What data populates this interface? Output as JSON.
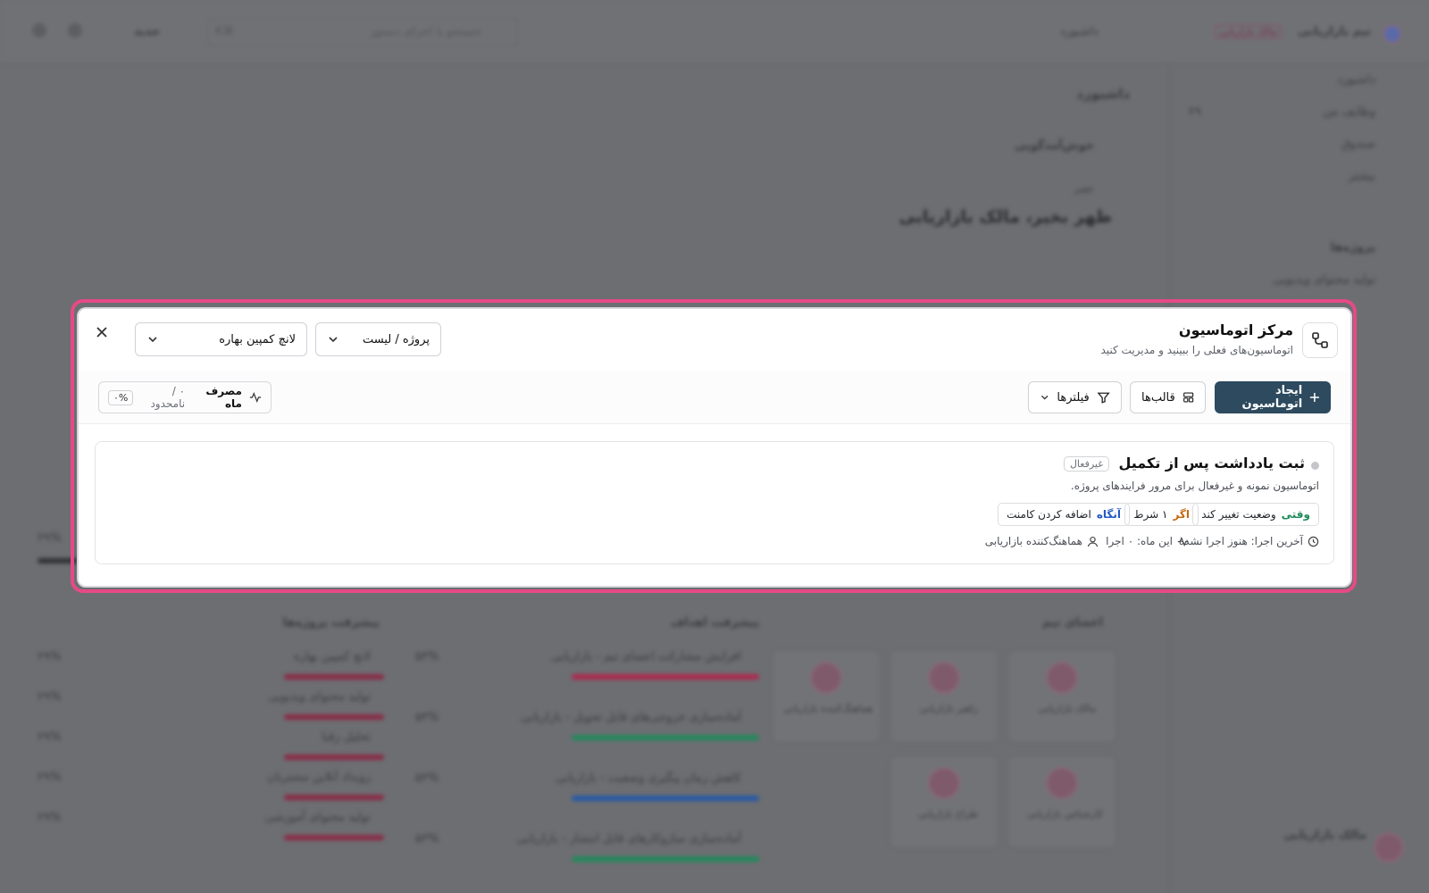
{
  "background": {
    "app_name": "تیم بازاریابی",
    "role_badge": "مالک بازاریابی",
    "dashboard_label": "داشبورد",
    "search_placeholder": "جستجو یا اجرای دستور",
    "search_shortcut": "⌘K",
    "new_label": "جدید",
    "page_title": "داشبورد",
    "welcome_label": "خوش‌آمدگویی",
    "greeting_small": "عصر",
    "greeting": "ظهر بخیر، مالک بازاریابی",
    "sidebar_items": [
      {
        "label": "داشبورد",
        "count": ""
      },
      {
        "label": "وظایف من",
        "count": "۲۹"
      },
      {
        "label": "صندوق",
        "count": ""
      },
      {
        "label": "بیشتر",
        "count": ""
      },
      {
        "label": "پروژه‌ها",
        "count": ""
      },
      {
        "label": "تولید محتوای ویدیویی",
        "count": "۲۹"
      }
    ],
    "team_members_title": "اعضای تیم",
    "goals_progress_title": "پیشرفت اهداف",
    "projects_progress_title": "پیشرفت پروژه‌ها",
    "team_members": [
      {
        "name": "مالک بازاریابی"
      },
      {
        "name": "راهبر بازاریابی"
      },
      {
        "name": "هماهنگ‌کننده بازاریابی"
      },
      {
        "name": "کارشناس بازاریابی"
      },
      {
        "name": "طراح بازاریابی"
      }
    ],
    "goals": [
      {
        "label": "افزایش مشارکت اعضای تیم - بازاریابی",
        "pct": "۵۳%",
        "color": "#b0254e"
      },
      {
        "label": "آماده‌سازی خروجی‌های قابل تحویل - بازاریابی",
        "pct": "۵۳%",
        "color": "#1f8a5b"
      },
      {
        "label": "کاهش زمان پیگیری وضعیت - بازاریابی",
        "pct": "۵۳%",
        "color": "#2458a8"
      },
      {
        "label": "آماده‌سازی سازوکارهای قابل انتشار - بازاریابی",
        "pct": "۵۳%",
        "color": "#1f8a5b"
      }
    ],
    "projects": [
      {
        "label": "لانچ کمپین بهاره",
        "pct": "۲۹%"
      },
      {
        "label": "تولید محتوای ویدیویی",
        "pct": "۲۹%"
      },
      {
        "label": "تحلیل رقبا",
        "pct": "۲۹%"
      },
      {
        "label": "رویداد آنلاین مشتریان",
        "pct": "۲۹%"
      },
      {
        "label": "تولید محتوای آموزشی",
        "pct": "۲۹%"
      }
    ],
    "user_name": "مالک بازاریابی",
    "left_pct": "۲۹%"
  },
  "modal": {
    "title": "مرکز اتوماسیون",
    "subtitle": "اتوماسیون‌های فعلی را ببینید و مدیریت کنید",
    "project_select": "پروژه / لیست",
    "campaign_select": "لانچ کمپین بهاره",
    "toolbar": {
      "create_label": "ایجاد اتوماسیون",
      "templates_label": "قالب‌ها",
      "filters_label": "فیلترها",
      "usage_label": "مصرف ماه",
      "usage_value": "۰ / نامحدود",
      "usage_pct": "۰%"
    },
    "automation": {
      "title": "ثبت یادداشت پس از تکمیل",
      "status": "غیرفعال",
      "description": "اتوماسیون نمونه و غیرفعال برای مرور فرایندهای پروژه.",
      "when_key": "وقتی",
      "when_value": "وضعیت تغییر کند",
      "if_key": "اگر",
      "if_value": "۱ شرط",
      "then_key": "آنگاه",
      "then_value": "اضافه کردن کامنت",
      "last_run": "آخرین اجرا: هنوز اجرا نشده",
      "month_runs": "این ماه: ۰ اجرا",
      "owner": "هماهنگ‌کننده بازاریابی"
    },
    "colors": {
      "primary": "#2d4a5e",
      "ring": "#e64a86",
      "when": "#1f8a5b",
      "if": "#c26a12",
      "then": "#2458c8"
    }
  }
}
